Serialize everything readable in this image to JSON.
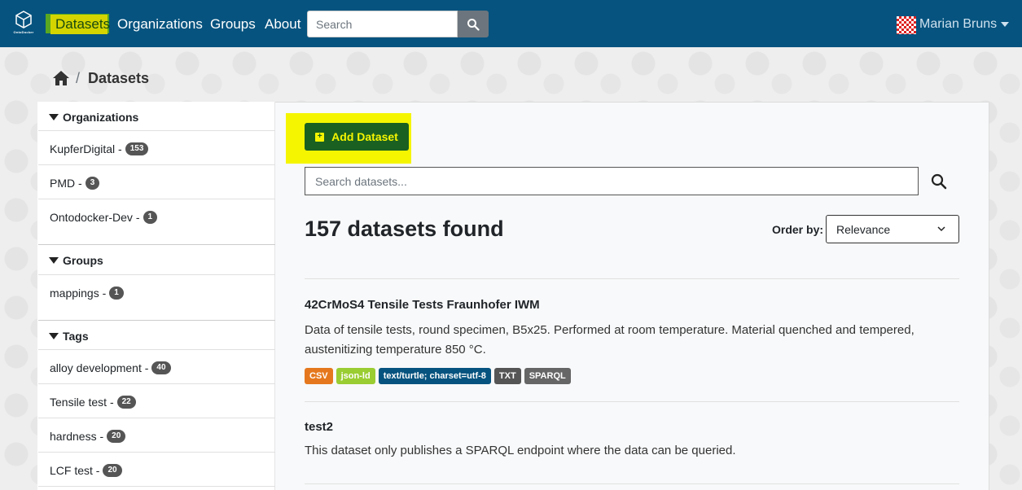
{
  "nav": {
    "logo_text": "OntoDocker",
    "items": [
      {
        "label": "Datasets"
      },
      {
        "label": "Organizations"
      },
      {
        "label": "Groups"
      },
      {
        "label": "About"
      }
    ],
    "search_placeholder": "Search",
    "user_name": "Marian Bruns"
  },
  "breadcrumb": {
    "current": "Datasets",
    "separator": "/"
  },
  "sidebar": {
    "organizations": {
      "heading": "Organizations",
      "items": [
        {
          "label": "KupferDigital",
          "count": "153"
        },
        {
          "label": "PMD",
          "count": "3"
        },
        {
          "label": "Ontodocker-Dev",
          "count": "1"
        }
      ]
    },
    "groups": {
      "heading": "Groups",
      "items": [
        {
          "label": "mappings",
          "count": "1"
        }
      ]
    },
    "tags": {
      "heading": "Tags",
      "items": [
        {
          "label": "alloy development",
          "count": "40"
        },
        {
          "label": "Tensile test",
          "count": "22"
        },
        {
          "label": "hardness",
          "count": "20"
        },
        {
          "label": "LCF test",
          "count": "20"
        }
      ]
    },
    "dash": "-"
  },
  "main": {
    "add_label": "Add Dataset",
    "search_placeholder": "Search datasets...",
    "found_text": "157 datasets found",
    "order_label": "Order by:",
    "order_value": "Relevance",
    "datasets": [
      {
        "title": "42CrMoS4 Tensile Tests Fraunhofer IWM",
        "description": "Data of tensile tests, round specimen, B5x25. Performed at room temperature. Material quenched and tempered, austenitizing temperature 850 °C.",
        "formats": [
          "CSV",
          "json-ld",
          "text/turtle; charset=utf-8",
          "TXT",
          "SPARQL"
        ]
      },
      {
        "title": "test2",
        "description": "This dataset only publishes a SPARQL endpoint where the data can be queried."
      }
    ]
  },
  "colors": {
    "nav_bg": "#06537f",
    "add_btn_bg": "#1a6020",
    "highlight": "#f5f500",
    "csv": "#e5781e",
    "jsonld": "#9acd32",
    "turtle": "#06537f",
    "txt": "#555555",
    "sparql": "#666666"
  }
}
